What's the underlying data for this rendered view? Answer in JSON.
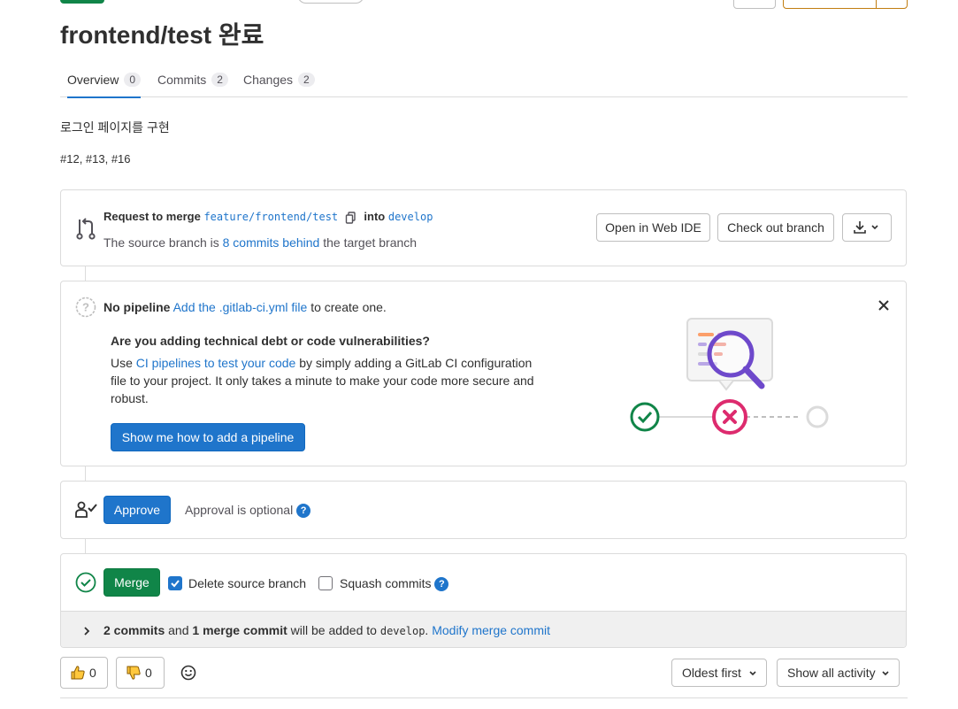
{
  "header": {
    "title": "frontend/test 완료"
  },
  "tabs": [
    {
      "label": "Overview",
      "count": "0"
    },
    {
      "label": "Commits",
      "count": "2"
    },
    {
      "label": "Changes",
      "count": "2"
    }
  ],
  "description": {
    "line1": "로그인 페이지를 구현",
    "line2": "#12, #13, #16"
  },
  "merge_request": {
    "request_to_merge": "Request to merge",
    "source_branch": "feature/frontend/test",
    "into": "into",
    "target_branch": "develop",
    "behind_prefix": "The source branch is",
    "behind_link": "8 commits behind",
    "behind_suffix": "the target branch",
    "open_web_ide": "Open in Web IDE",
    "check_out_branch": "Check out branch"
  },
  "pipeline": {
    "no_pipeline": "No pipeline",
    "add_link": "Add the .gitlab-ci.yml file",
    "add_suffix": "to create one.",
    "heading": "Are you adding technical debt or code vulnerabilities?",
    "body_prefix": "Use",
    "body_link": "CI pipelines to test your code",
    "body_line1_suffix": "by simply adding a GitLab CI configuration",
    "body_line2": "file to your project. It only takes a minute to make your code more secure and",
    "body_line3": "robust.",
    "cta": "Show me how to add a pipeline"
  },
  "approval": {
    "approve": "Approve",
    "optional": "Approval is optional"
  },
  "merge": {
    "merge": "Merge",
    "delete_source": "Delete source branch",
    "delete_source_checked": true,
    "squash": "Squash commits",
    "squash_checked": false,
    "commits_count": "2 commits",
    "and": "and",
    "merge_commit": "1 merge commit",
    "added_to": "will be added to",
    "branch": "develop",
    "period": ".",
    "modify": "Modify merge commit"
  },
  "reactions": {
    "thumbs_up": "0",
    "thumbs_down": "0"
  },
  "activity": {
    "sort": "Oldest first",
    "filter": "Show all activity"
  },
  "colors": {
    "link": "#1f75cb",
    "primary": "#1f75cb",
    "success": "#108548",
    "danger": "#dd2b0e"
  }
}
